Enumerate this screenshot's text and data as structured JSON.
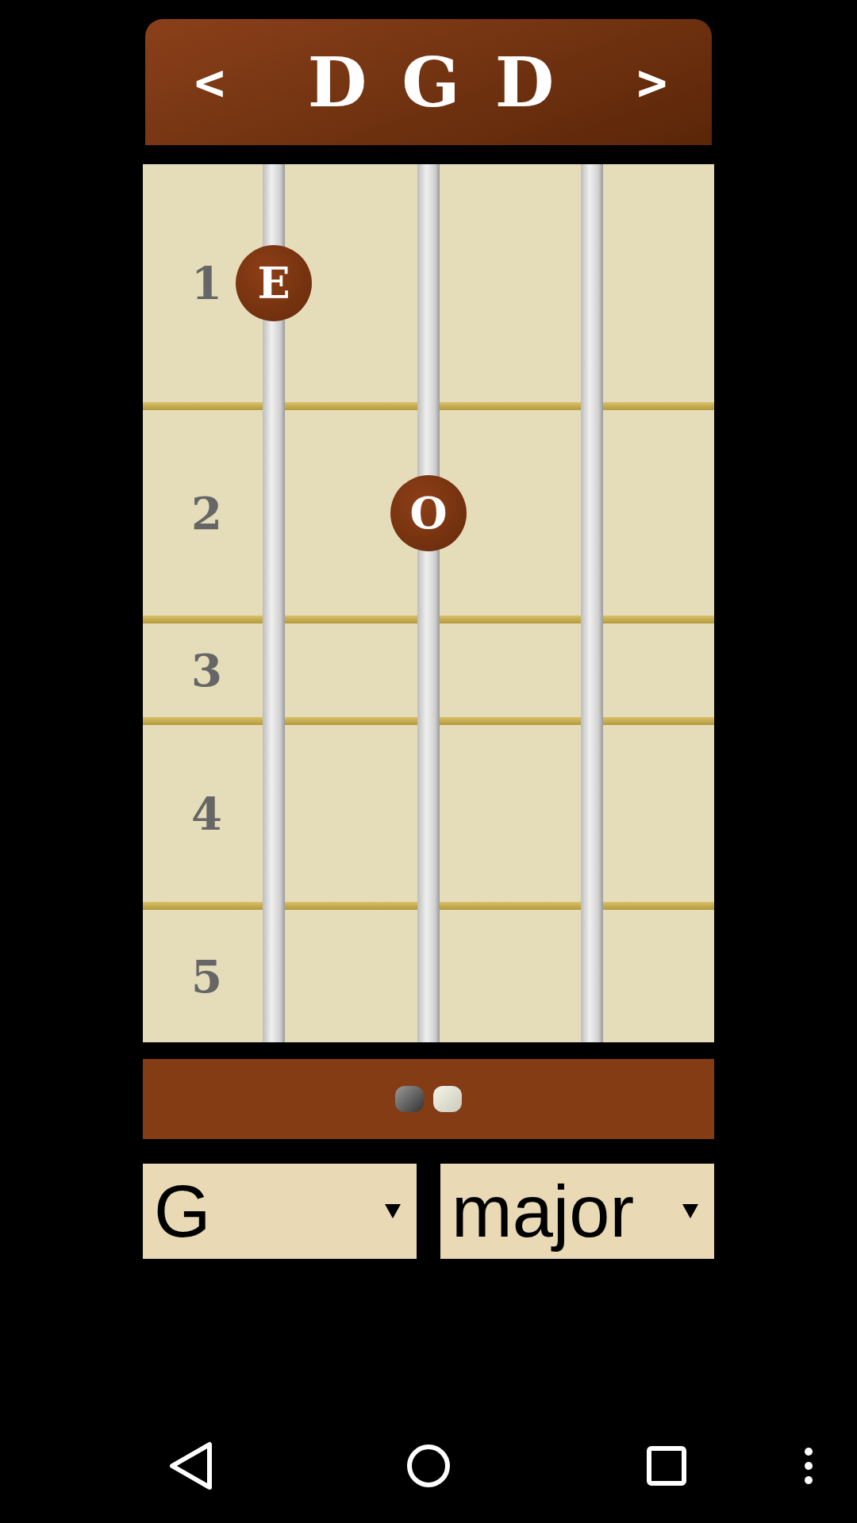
{
  "header": {
    "prev": "<",
    "next": ">",
    "notes": [
      "D",
      "G",
      "D"
    ]
  },
  "fretboard": {
    "frets": [
      {
        "label": "1",
        "positions": [
          {
            "kind": "marker",
            "label": "E"
          },
          {
            "kind": "none"
          },
          {
            "kind": "none"
          }
        ]
      },
      {
        "label": "2",
        "positions": [
          {
            "kind": "none"
          },
          {
            "kind": "marker",
            "label": "O"
          },
          {
            "kind": "none"
          }
        ]
      },
      {
        "label": "3",
        "positions": [
          {
            "kind": "none"
          },
          {
            "kind": "none"
          },
          {
            "kind": "none"
          }
        ]
      },
      {
        "label": "4",
        "positions": [
          {
            "kind": "none"
          },
          {
            "kind": "none"
          },
          {
            "kind": "none"
          }
        ]
      },
      {
        "label": "5",
        "positions": [
          {
            "kind": "none"
          },
          {
            "kind": "none"
          },
          {
            "kind": "none"
          }
        ]
      }
    ]
  },
  "pager": [
    {
      "selected": true
    },
    {
      "selected": false
    }
  ],
  "selectors": [
    {
      "value": "G"
    },
    {
      "value": "major"
    }
  ]
}
